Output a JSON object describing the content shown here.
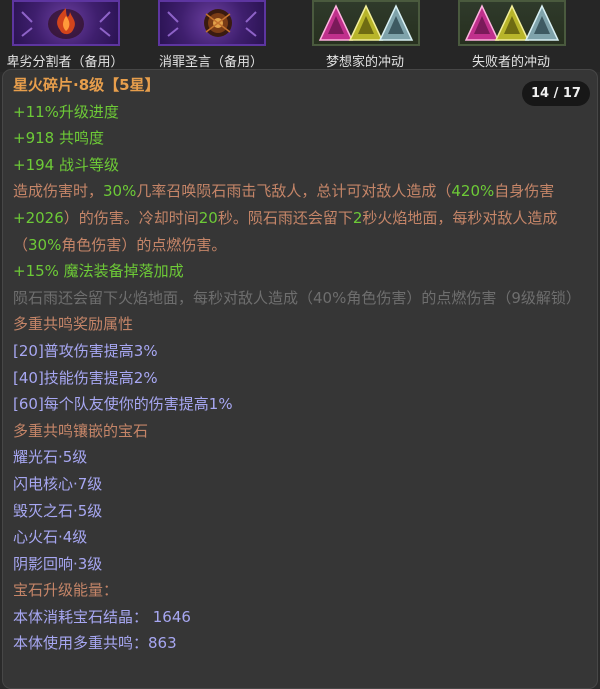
{
  "slots": [
    {
      "caption": "卑劣分割者（备用）",
      "icon": "flame-orb-icon"
    },
    {
      "caption": "消罪圣言（备用）",
      "icon": "ember-orb-icon"
    },
    {
      "caption": "梦想家的冲动",
      "icon": "triangle-gems-icon"
    },
    {
      "caption": "失败者的冲动",
      "icon": "triangle-gems-icon"
    }
  ],
  "counter": "14 / 17",
  "item": {
    "title": "星火碎片·8级【5星】",
    "stats": [
      "+11%升级进度",
      "+918 共鸣度",
      "+194 战斗等级"
    ],
    "description": {
      "p1": "造成伤害时，",
      "pct": "30%",
      "p2": "几率召唤陨石雨击飞敌人，总计可对敌人造成（",
      "dmg": "420%",
      "p3": "自身伤害",
      "flat": "+2026",
      "p4": "）的伤害。冷却时间",
      "cd": "20",
      "p5": "秒。陨石雨还会留下",
      "dur": "2",
      "p6": "秒火焰地面，每秒对敌人造成（",
      "burn": "30%",
      "p7": "角色伤害）的点燃伤害。"
    },
    "bonus": "+15% 魔法装备掉落加成",
    "locked": "陨石雨还会留下火焰地面，每秒对敌人造成（40%角色伤害）的点燃伤害（9级解锁）",
    "resonance_heading": "多重共鸣奖励属性",
    "resonance_rewards": [
      "[20]普攻伤害提高3%",
      "[40]技能伤害提高2%",
      "[60]每个队友使你的伤害提高1%"
    ],
    "gems_heading": "多重共鸣镶嵌的宝石",
    "gems": [
      "耀光石·5级",
      "闪电核心·7级",
      "毁灭之石·5级",
      "心火石·4级",
      "阴影回响·3级"
    ],
    "energy_heading": "宝石升级能量：",
    "energy_consumed": "本体消耗宝石结晶：  1646",
    "energy_partial": "本体使用多重共鸣：863"
  },
  "colors": {
    "title": "#e79e4c",
    "stat": "#6dca37",
    "description": "#c58568",
    "locked": "#6e6e6e",
    "resonance": "#a7a7f2"
  }
}
